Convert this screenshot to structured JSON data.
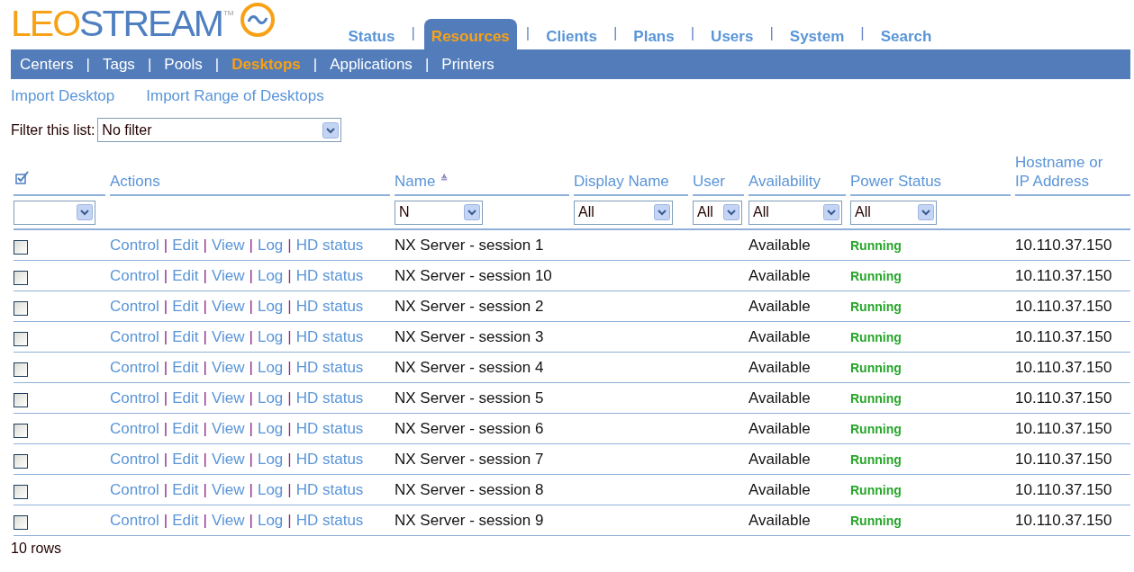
{
  "logo": {
    "part_1": "LEO",
    "part_2": "STREAM",
    "trademark": "TM"
  },
  "main_tabs": [
    {
      "label": "Status",
      "selected": false
    },
    {
      "label": "Resources",
      "selected": true
    },
    {
      "label": "Clients",
      "selected": false
    },
    {
      "label": "Plans",
      "selected": false
    },
    {
      "label": "Users",
      "selected": false
    },
    {
      "label": "System",
      "selected": false
    },
    {
      "label": "Search",
      "selected": false
    }
  ],
  "sub_tabs": [
    {
      "label": "Centers",
      "selected": false
    },
    {
      "label": "Tags",
      "selected": false
    },
    {
      "label": "Pools",
      "selected": false
    },
    {
      "label": "Desktops",
      "selected": true
    },
    {
      "label": "Applications",
      "selected": false
    },
    {
      "label": "Printers",
      "selected": false
    }
  ],
  "separator": "|",
  "action_links": [
    "Import Desktop",
    "Import Range of Desktops"
  ],
  "filter": {
    "label": "Filter this list:",
    "value": "No filter"
  },
  "table": {
    "columns": [
      {
        "kind": "check"
      },
      {
        "kind": "text",
        "label": "Actions"
      },
      {
        "kind": "sorted",
        "label": "Name",
        "sort_mark": "≜"
      },
      {
        "kind": "text",
        "label": "Display Name"
      },
      {
        "kind": "text",
        "label": "User"
      },
      {
        "kind": "text",
        "label": "Availability"
      },
      {
        "kind": "text",
        "label": "Power Status"
      },
      {
        "kind": "text",
        "label": "Hostname or IP Address"
      }
    ],
    "filters": [
      {
        "kind": "select"
      },
      {
        "kind": "none"
      },
      {
        "kind": "select",
        "value": "N"
      },
      {
        "kind": "select",
        "value": "All"
      },
      {
        "kind": "select",
        "value": "All"
      },
      {
        "kind": "select",
        "value": "All"
      },
      {
        "kind": "select",
        "value": "All"
      },
      {
        "kind": "none"
      }
    ],
    "rows": [
      {
        "checked": false,
        "actions": [
          "Control",
          "Edit",
          "View",
          "Log",
          "HD status"
        ],
        "name": "NX Server - session 1",
        "availability": "Available",
        "power_status": "Running",
        "host": "10.110.37.150"
      },
      {
        "checked": false,
        "actions": [
          "Control",
          "Edit",
          "View",
          "Log",
          "HD status"
        ],
        "name": "NX Server - session 10",
        "availability": "Available",
        "power_status": "Running",
        "host": "10.110.37.150"
      },
      {
        "checked": false,
        "actions": [
          "Control",
          "Edit",
          "View",
          "Log",
          "HD status"
        ],
        "name": "NX Server - session 2",
        "availability": "Available",
        "power_status": "Running",
        "host": "10.110.37.150"
      },
      {
        "checked": false,
        "actions": [
          "Control",
          "Edit",
          "View",
          "Log",
          "HD status"
        ],
        "name": "NX Server - session 3",
        "availability": "Available",
        "power_status": "Running",
        "host": "10.110.37.150"
      },
      {
        "checked": false,
        "actions": [
          "Control",
          "Edit",
          "View",
          "Log",
          "HD status"
        ],
        "name": "NX Server - session 4",
        "availability": "Available",
        "power_status": "Running",
        "host": "10.110.37.150"
      },
      {
        "checked": false,
        "actions": [
          "Control",
          "Edit",
          "View",
          "Log",
          "HD status"
        ],
        "name": "NX Server - session 5",
        "availability": "Available",
        "power_status": "Running",
        "host": "10.110.37.150"
      },
      {
        "checked": false,
        "actions": [
          "Control",
          "Edit",
          "View",
          "Log",
          "HD status"
        ],
        "name": "NX Server - session 6",
        "availability": "Available",
        "power_status": "Running",
        "host": "10.110.37.150"
      },
      {
        "checked": false,
        "actions": [
          "Control",
          "Edit",
          "View",
          "Log",
          "HD status"
        ],
        "name": "NX Server - session 7",
        "availability": "Available",
        "power_status": "Running",
        "host": "10.110.37.150"
      },
      {
        "checked": false,
        "actions": [
          "Control",
          "Edit",
          "View",
          "Log",
          "HD status"
        ],
        "name": "NX Server - session 8",
        "availability": "Available",
        "power_status": "Running",
        "host": "10.110.37.150"
      },
      {
        "checked": false,
        "actions": [
          "Control",
          "Edit",
          "View",
          "Log",
          "HD status"
        ],
        "name": "NX Server - session 9",
        "availability": "Available",
        "power_status": "Running",
        "host": "10.110.37.150"
      }
    ]
  },
  "row_count": "10 rows"
}
